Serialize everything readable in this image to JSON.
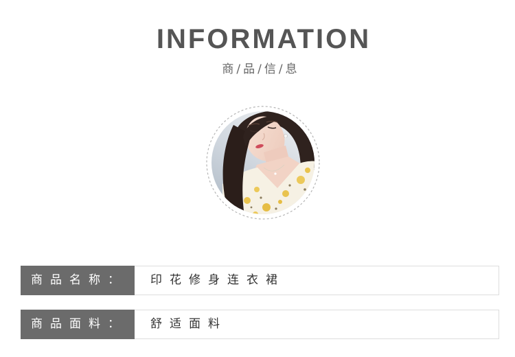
{
  "header": {
    "title": "INFORMATION",
    "subtitle": "商/品/信/息"
  },
  "specs": [
    {
      "label": "商品名称：",
      "value": "印花修身连衣裙"
    },
    {
      "label": "商品面料：",
      "value": "舒适面料"
    }
  ],
  "theme": {
    "title_color": "#555555",
    "subtitle_color": "#666666",
    "label_bg": "#6b6b6b",
    "label_text": "#ffffff",
    "value_text": "#333333",
    "border": "#dddddd",
    "ring": "#b5b5b5"
  }
}
